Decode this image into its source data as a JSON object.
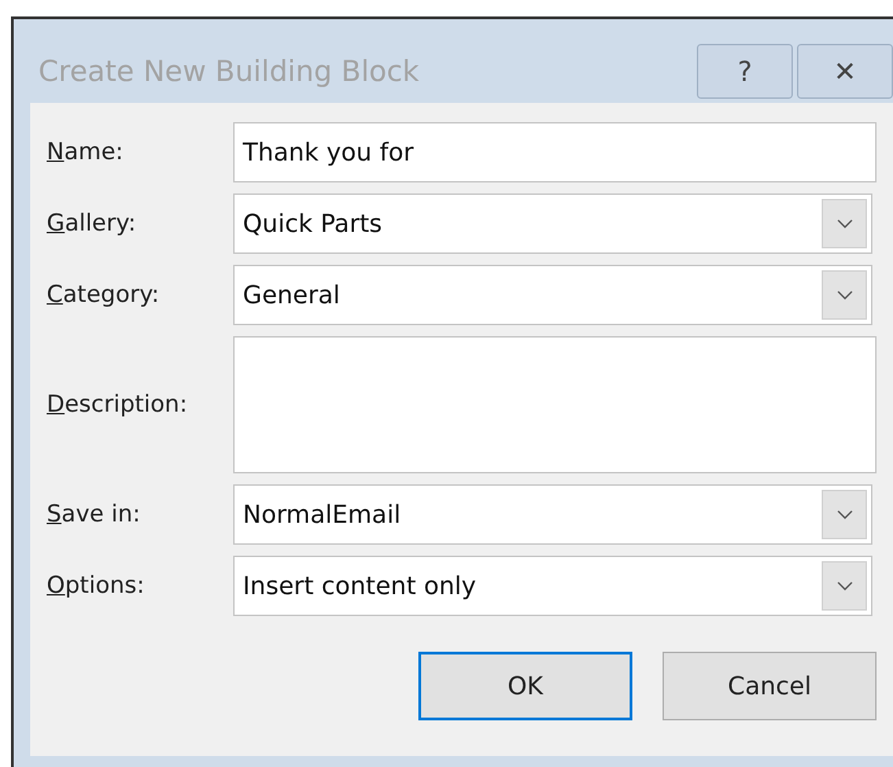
{
  "window": {
    "title": "Create New Building Block",
    "help_button": "?",
    "close_button": "✕"
  },
  "fields": [
    {
      "key": "N",
      "label_rest": "ame:",
      "kind": "text",
      "value": "Thank you for"
    },
    {
      "key": "G",
      "label_rest": "allery:",
      "kind": "combo",
      "value": "Quick Parts"
    },
    {
      "key": "C",
      "label_rest": "ategory:",
      "kind": "combo",
      "value": "General"
    },
    {
      "key": "D",
      "label_rest": "escription:",
      "kind": "textarea"
    },
    {
      "key": "S",
      "label_rest": "ave in:",
      "kind": "combo",
      "value": "NormalEmail"
    },
    {
      "key": "O",
      "label_rest": "ptions:",
      "kind": "combo",
      "value": "Insert content only"
    }
  ],
  "buttons": [
    {
      "label": "OK",
      "default": true
    },
    {
      "label": "Cancel",
      "default": false
    }
  ]
}
